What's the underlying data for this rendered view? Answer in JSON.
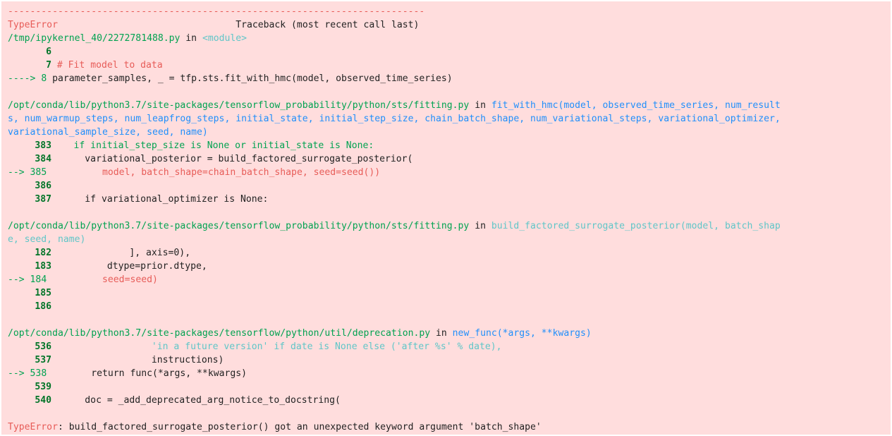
{
  "separator": "---------------------------------------------------------------------------",
  "header": {
    "error_type": "TypeError",
    "title": "Traceback (most recent call last)"
  },
  "frames": [
    {
      "file": "/tmp/ipykernel_40/2272781488.py",
      "in_label": " in ",
      "func": "<module>",
      "lines": [
        {
          "num": "6",
          "code": ""
        },
        {
          "num": "7",
          "code": "# Fit model to data"
        },
        {
          "num": "8",
          "arrow": "----> ",
          "code": "parameter_samples, _ = tfp.sts.fit_with_hmc(model, observed_time_series)"
        }
      ]
    },
    {
      "file": "/opt/conda/lib/python3.7/site-packages/tensorflow_probability/python/sts/fitting.py",
      "in_label": " in ",
      "func": "fit_with_hmc(model, observed_time_series, num_result",
      "sig_cont": [
        "s, num_warmup_steps, num_leapfrog_steps, initial_state, initial_step_size, chain_batch_shape, num_variational_steps, variational_optimizer,",
        "variational_sample_size, seed, name)"
      ],
      "lines": [
        {
          "num": "383",
          "code": "    if initial_step_size is None or initial_state is None:"
        },
        {
          "num": "384",
          "code": "      variational_posterior = build_factored_surrogate_posterior("
        },
        {
          "num": "385",
          "arrow": "--> ",
          "code": "          model, batch_shape=chain_batch_shape, seed=seed())"
        },
        {
          "num": "386",
          "code": ""
        },
        {
          "num": "387",
          "code": "      if variational_optimizer is None:"
        }
      ]
    },
    {
      "file": "/opt/conda/lib/python3.7/site-packages/tensorflow_probability/python/sts/fitting.py",
      "in_label": " in ",
      "func": "build_factored_surrogate_posterior(model, batch_shap",
      "sig_cont": [
        "e, seed, name)"
      ],
      "lines": [
        {
          "num": "182",
          "code": "              ], axis=0),"
        },
        {
          "num": "183",
          "code": "          dtype=prior.dtype,"
        },
        {
          "num": "184",
          "arrow": "--> ",
          "code": "          seed=seed)"
        },
        {
          "num": "185",
          "code": ""
        },
        {
          "num": "186",
          "code": ""
        }
      ]
    },
    {
      "file": "/opt/conda/lib/python3.7/site-packages/tensorflow/python/util/deprecation.py",
      "in_label": " in ",
      "func": "new_func(*args, **kwargs)",
      "lines": [
        {
          "num": "536",
          "code": "                  'in a future version' if date is None else ('after %s' % date),"
        },
        {
          "num": "537",
          "code": "                  instructions)"
        },
        {
          "num": "538",
          "arrow": "--> ",
          "code": "        return func(*args, **kwargs)"
        },
        {
          "num": "539",
          "code": ""
        },
        {
          "num": "540",
          "code": "      doc = _add_deprecated_arg_notice_to_docstring("
        }
      ]
    }
  ],
  "final_error": {
    "type": "TypeError",
    "message": ": build_factored_surrogate_posterior() got an unexpected keyword argument 'batch_shape'"
  },
  "colors": {
    "background": "#ffdddd",
    "red": "#e75c58",
    "green": "#00a250",
    "blue": "#208ffb",
    "cyan": "#60c6c8"
  }
}
